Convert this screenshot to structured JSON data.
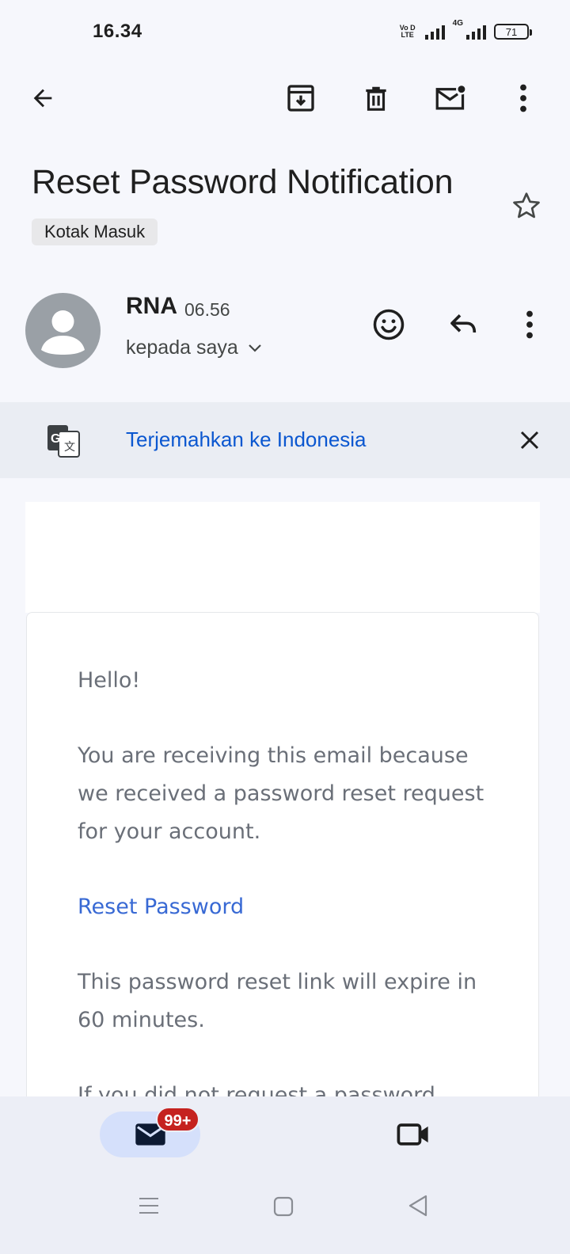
{
  "status_bar": {
    "time": "16.34",
    "volte_top": "Vo D",
    "volte_bottom": "LTE",
    "network": "4G",
    "battery": "71"
  },
  "toolbar": {
    "back_icon": "arrow-back-icon",
    "archive_icon": "archive-icon",
    "delete_icon": "trash-icon",
    "mark_unread_icon": "mark-unread-icon",
    "more_icon": "more-vert-icon"
  },
  "email": {
    "subject": "Reset Password Notification",
    "label": "Kotak Masuk",
    "starred": false,
    "sender": "RNA",
    "time": "06.56",
    "recipients": "kepada saya"
  },
  "translate_bar": {
    "text": "Terjemahkan ke Indonesia"
  },
  "body": {
    "greeting": "Hello!",
    "paragraph1": "You are receiving this email because we received a password reset request for your account.",
    "link": "Reset Password",
    "paragraph2": "This password reset link will expire in 60 minutes.",
    "paragraph3": "If you did not request a password"
  },
  "bottom_nav": {
    "mail_badge": "99+",
    "mail_icon": "mail-icon",
    "meet_icon": "video-icon",
    "active_color": "#d5e0fb",
    "badge_color": "#c5221f"
  },
  "colors": {
    "link": "#0b57d0",
    "body_text": "#6a6f78",
    "email_link": "#3869d4"
  }
}
